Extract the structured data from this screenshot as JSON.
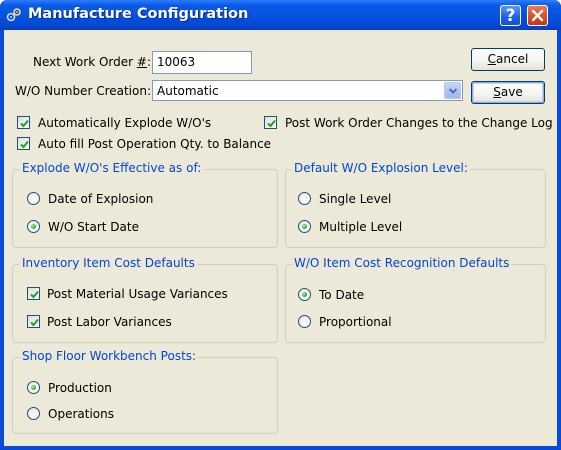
{
  "window": {
    "title": "Manufacture Configuration",
    "help_glyph": "?"
  },
  "form": {
    "next_wo_label_pre": "Next Work Order ",
    "next_wo_label_ul": "#",
    "next_wo_label_post": ":",
    "next_wo_value": "10063",
    "wo_creation_label": "W/O Number Creation:",
    "wo_creation_value": "Automatic"
  },
  "buttons": {
    "cancel_ul": "C",
    "cancel_rest": "ancel",
    "save_ul": "S",
    "save_rest": "ave"
  },
  "checks": {
    "explode_label": "Automatically Explode W/O's",
    "explode_checked": true,
    "post_changes_label": "Post Work Order Changes to the Change Log",
    "post_changes_checked": true,
    "autofill_label": "Auto fill Post Operation Qty. to Balance",
    "autofill_checked": true
  },
  "groups": {
    "explode_effective": {
      "title": "Explode W/O's Effective as of:",
      "options": [
        "Date of Explosion",
        "W/O Start Date"
      ],
      "selected": 1
    },
    "explosion_level": {
      "title": "Default W/O Explosion Level:",
      "options": [
        "Single Level",
        "Multiple Level"
      ],
      "selected": 1
    },
    "inventory_cost": {
      "title": "Inventory Item Cost Defaults",
      "options": [
        "Post Material Usage Variances",
        "Post Labor Variances"
      ],
      "checked": [
        true,
        true
      ]
    },
    "wo_cost_recognition": {
      "title": "W/O Item Cost Recognition Defaults",
      "options": [
        "To Date",
        "Proportional"
      ],
      "selected": 0
    },
    "shop_floor": {
      "title": "Shop Floor Workbench Posts:",
      "options": [
        "Production",
        "Operations"
      ],
      "selected": 0
    }
  },
  "colors": {
    "title_bar": "#0553e1",
    "dialog_bg": "#ece9d8",
    "group_title": "#0046d5",
    "radio_dot": "#2aa62a",
    "checkmark": "#21a121"
  }
}
